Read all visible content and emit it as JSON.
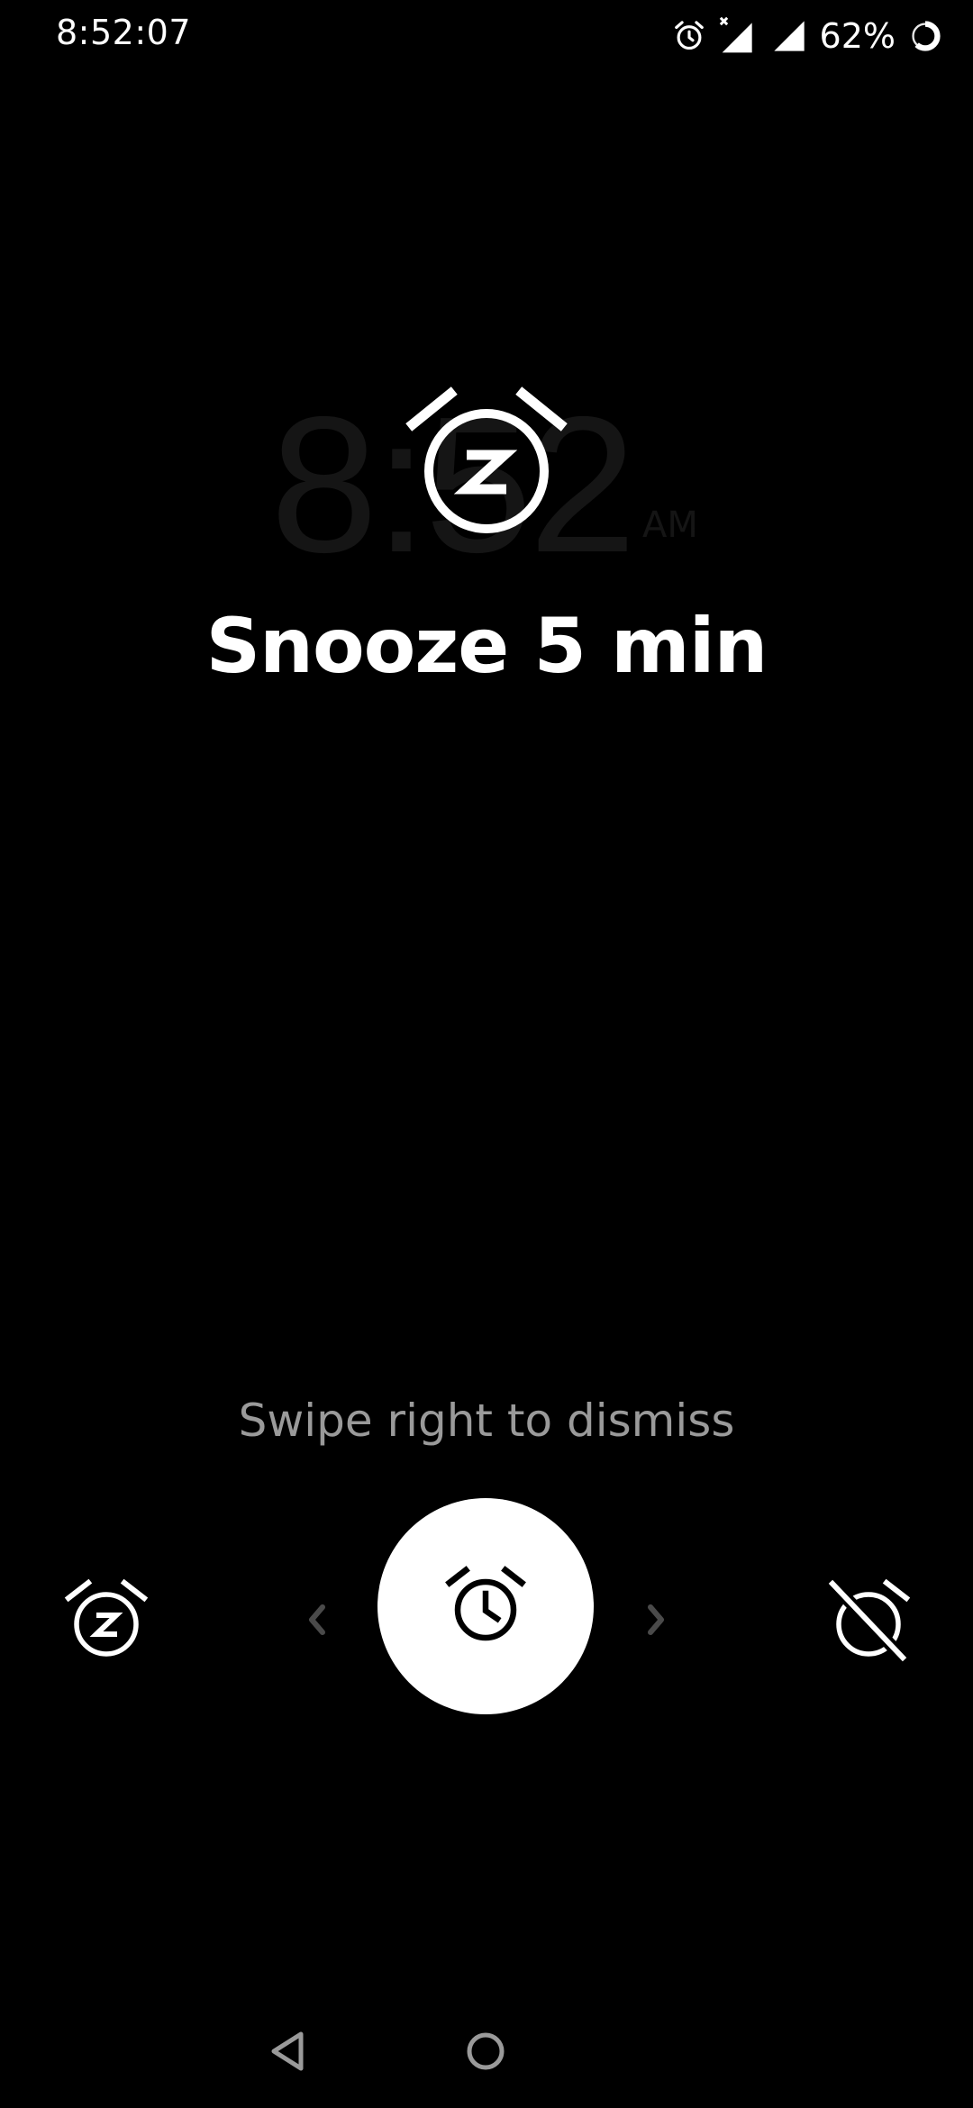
{
  "status_bar": {
    "time": "8:52:07",
    "battery_percent": "62%",
    "icons": [
      "alarm-icon",
      "signal-no-data-icon",
      "signal-icon",
      "battery-ring-icon"
    ]
  },
  "background_clock": {
    "time": "8:52",
    "ampm": "AM"
  },
  "snooze_state": {
    "icon": "snooze-alarm-icon",
    "title": "Snooze 5 min"
  },
  "swipe_hint": "Swipe right to dismiss",
  "controls": {
    "left_icon": "snooze-alarm-icon",
    "center_icon": "alarm-clock-icon",
    "right_icon": "alarm-off-icon",
    "left_arrow_icon": "chevron-left-icon",
    "right_arrow_icon": "chevron-right-icon"
  },
  "nav_bar": {
    "icons": [
      "back-triangle-icon",
      "home-circle-icon"
    ]
  },
  "colors": {
    "background": "#000000",
    "foreground": "#ffffff",
    "hint_text": "#9a9a9a",
    "ghost_clock": "#151515"
  }
}
